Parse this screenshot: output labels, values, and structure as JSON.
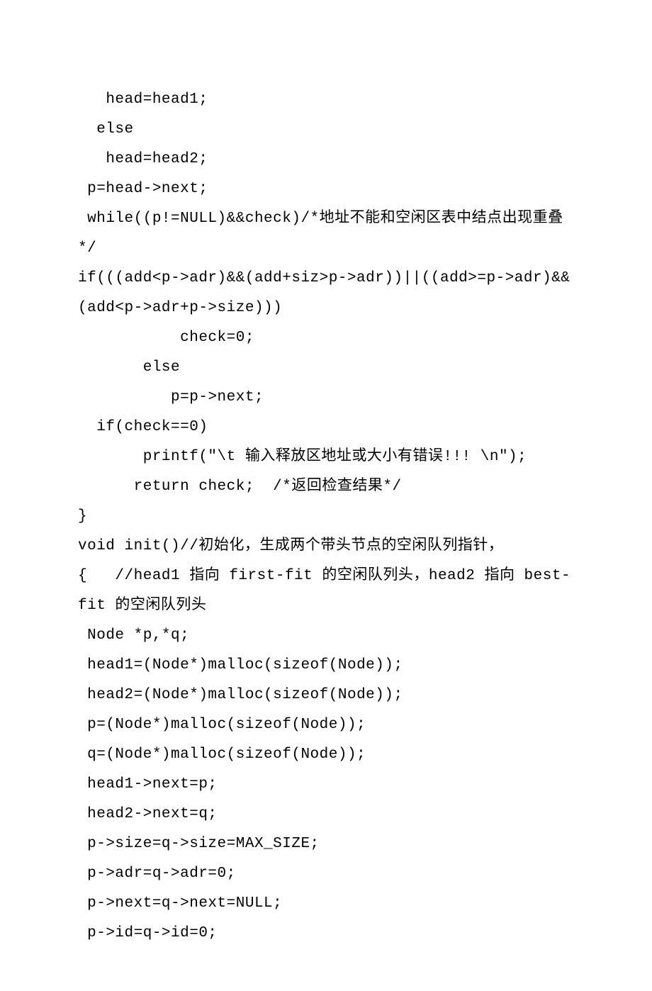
{
  "lines": [
    "   head=head1;",
    "  else",
    "   head=head2;",
    " p=head->next;",
    " while((p!=NULL)&&check)/*地址不能和空闲区表中结点出现重叠*/",
    "",
    "if(((add<p->adr)&&(add+siz>p->adr))||((add>=p->adr)&&(add<p->adr+p->size)))",
    "           check=0;",
    "       else",
    "          p=p->next;",
    "  if(check==0)",
    "       printf(\"\\t 输入释放区地址或大小有错误!!! \\n\");",
    "      return check;  /*返回检查结果*/",
    "}",
    "",
    "void init()//初始化，生成两个带头节点的空闲队列指针，",
    "{   //head1 指向 first-fit 的空闲队列头，head2 指向 best-fit 的空闲队列头",
    " Node *p,*q;",
    " head1=(Node*)malloc(sizeof(Node));",
    " head2=(Node*)malloc(sizeof(Node));",
    " p=(Node*)malloc(sizeof(Node));",
    " q=(Node*)malloc(sizeof(Node));",
    " head1->next=p;",
    " head2->next=q;",
    " p->size=q->size=MAX_SIZE;",
    " p->adr=q->adr=0;",
    " p->next=q->next=NULL;",
    " p->id=q->id=0;"
  ]
}
